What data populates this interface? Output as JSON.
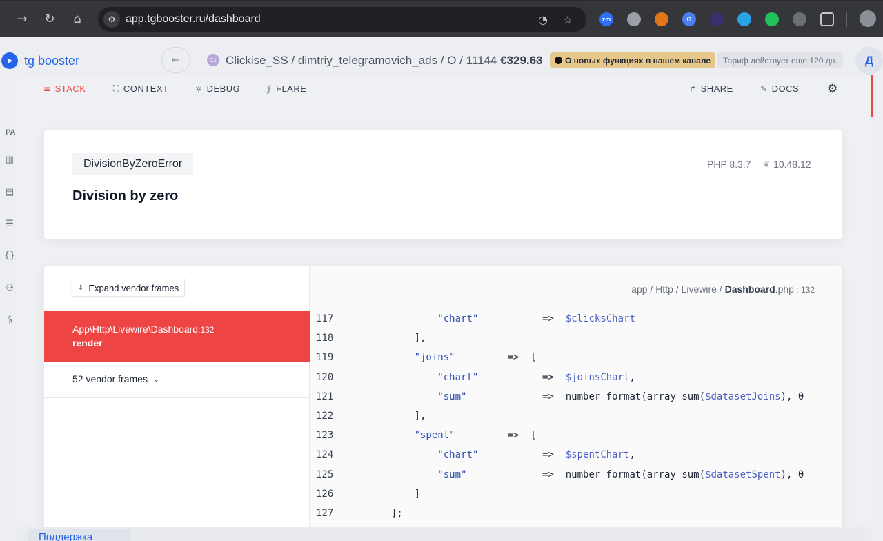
{
  "browser": {
    "url": "app.tgbooster.ru/dashboard",
    "extensions": [
      {
        "name": "zoom-extension-icon",
        "label": "zm",
        "color": "#2d6ff7"
      },
      {
        "name": "stack-extension-icon",
        "label": "",
        "color": "#9aa0a6"
      },
      {
        "name": "metamask-extension-icon",
        "label": "",
        "color": "#e2761b"
      },
      {
        "name": "translate-extension-icon",
        "label": "G",
        "color": "#4a7df0"
      },
      {
        "name": "vpn-extension-icon",
        "label": "",
        "color": "#3b2e6e"
      },
      {
        "name": "telegram-extension-icon",
        "label": "",
        "color": "#2aa3e6"
      },
      {
        "name": "green-extension-icon",
        "label": "",
        "color": "#21c15b"
      },
      {
        "name": "grey-extension-icon",
        "label": "",
        "color": "#6b6f75"
      },
      {
        "name": "puzzle-extensions-icon",
        "label": "",
        "color": "#35363a"
      }
    ]
  },
  "app": {
    "logo": "tg booster",
    "breadcrumb_badge": "C1",
    "breadcrumb": "Clickise_SS / dimtriy_telegramovich_ads / O / 11144",
    "balance": "€329.63",
    "news": "О новых функциях в нашем канале",
    "tariff": "Тариф действует еще 120 дн.",
    "avatar": "Д",
    "sidebar_label": "PA",
    "support": "Поддержка"
  },
  "ignition": {
    "tabs": [
      {
        "label": "STACK",
        "icon": "≡"
      },
      {
        "label": "CONTEXT",
        "icon": "⛶"
      },
      {
        "label": "DEBUG",
        "icon": "✲"
      },
      {
        "label": "FLARE",
        "icon": "ϝ"
      }
    ],
    "share": "SHARE",
    "docs": "DOCS",
    "exception_class": "DivisionByZeroError",
    "message": "Division by zero",
    "php_version": "PHP 8.3.7",
    "laravel_version": "10.48.12",
    "expand_vendor": "Expand vendor frames",
    "active_frame": {
      "class": "App\\Http\\Livewire\\Dashboard",
      "line": "132",
      "method": "render"
    },
    "vendor_frames": "52 vendor frames",
    "file": {
      "dir": "app / Http / Livewire / ",
      "name": "Dashboard",
      "ext": ".php",
      "line": "132"
    },
    "code_lines": [
      {
        "num": "117",
        "parts": [
          {
            "t": "          ",
            "c": ""
          },
          {
            "t": "\"chart\"",
            "c": "str"
          },
          {
            "t": "           =>  ",
            "c": ""
          },
          {
            "t": "$clicksChart",
            "c": "var"
          }
        ]
      },
      {
        "num": "118",
        "parts": [
          {
            "t": "      ],",
            "c": ""
          }
        ]
      },
      {
        "num": "119",
        "parts": [
          {
            "t": "      ",
            "c": ""
          },
          {
            "t": "\"joins\"",
            "c": "str"
          },
          {
            "t": "         =>  [",
            "c": ""
          }
        ]
      },
      {
        "num": "120",
        "parts": [
          {
            "t": "          ",
            "c": ""
          },
          {
            "t": "\"chart\"",
            "c": "str"
          },
          {
            "t": "           =>  ",
            "c": ""
          },
          {
            "t": "$joinsChart",
            "c": "var"
          },
          {
            "t": ",",
            "c": ""
          }
        ]
      },
      {
        "num": "121",
        "parts": [
          {
            "t": "          ",
            "c": ""
          },
          {
            "t": "\"sum\"",
            "c": "str"
          },
          {
            "t": "             =>  number_format(array_sum(",
            "c": ""
          },
          {
            "t": "$datasetJoins",
            "c": "var"
          },
          {
            "t": "), 0",
            "c": ""
          }
        ]
      },
      {
        "num": "122",
        "parts": [
          {
            "t": "      ],",
            "c": ""
          }
        ]
      },
      {
        "num": "123",
        "parts": [
          {
            "t": "      ",
            "c": ""
          },
          {
            "t": "\"spent\"",
            "c": "str"
          },
          {
            "t": "         =>  [",
            "c": ""
          }
        ]
      },
      {
        "num": "124",
        "parts": [
          {
            "t": "          ",
            "c": ""
          },
          {
            "t": "\"chart\"",
            "c": "str"
          },
          {
            "t": "           =>  ",
            "c": ""
          },
          {
            "t": "$spentChart",
            "c": "var"
          },
          {
            "t": ",",
            "c": ""
          }
        ]
      },
      {
        "num": "125",
        "parts": [
          {
            "t": "          ",
            "c": ""
          },
          {
            "t": "\"sum\"",
            "c": "str"
          },
          {
            "t": "             =>  number_format(array_sum(",
            "c": ""
          },
          {
            "t": "$datasetSpent",
            "c": "var"
          },
          {
            "t": "), 0",
            "c": ""
          }
        ]
      },
      {
        "num": "126",
        "parts": [
          {
            "t": "      ]",
            "c": ""
          }
        ]
      },
      {
        "num": "127",
        "parts": [
          {
            "t": "  ];",
            "c": ""
          }
        ]
      }
    ]
  }
}
